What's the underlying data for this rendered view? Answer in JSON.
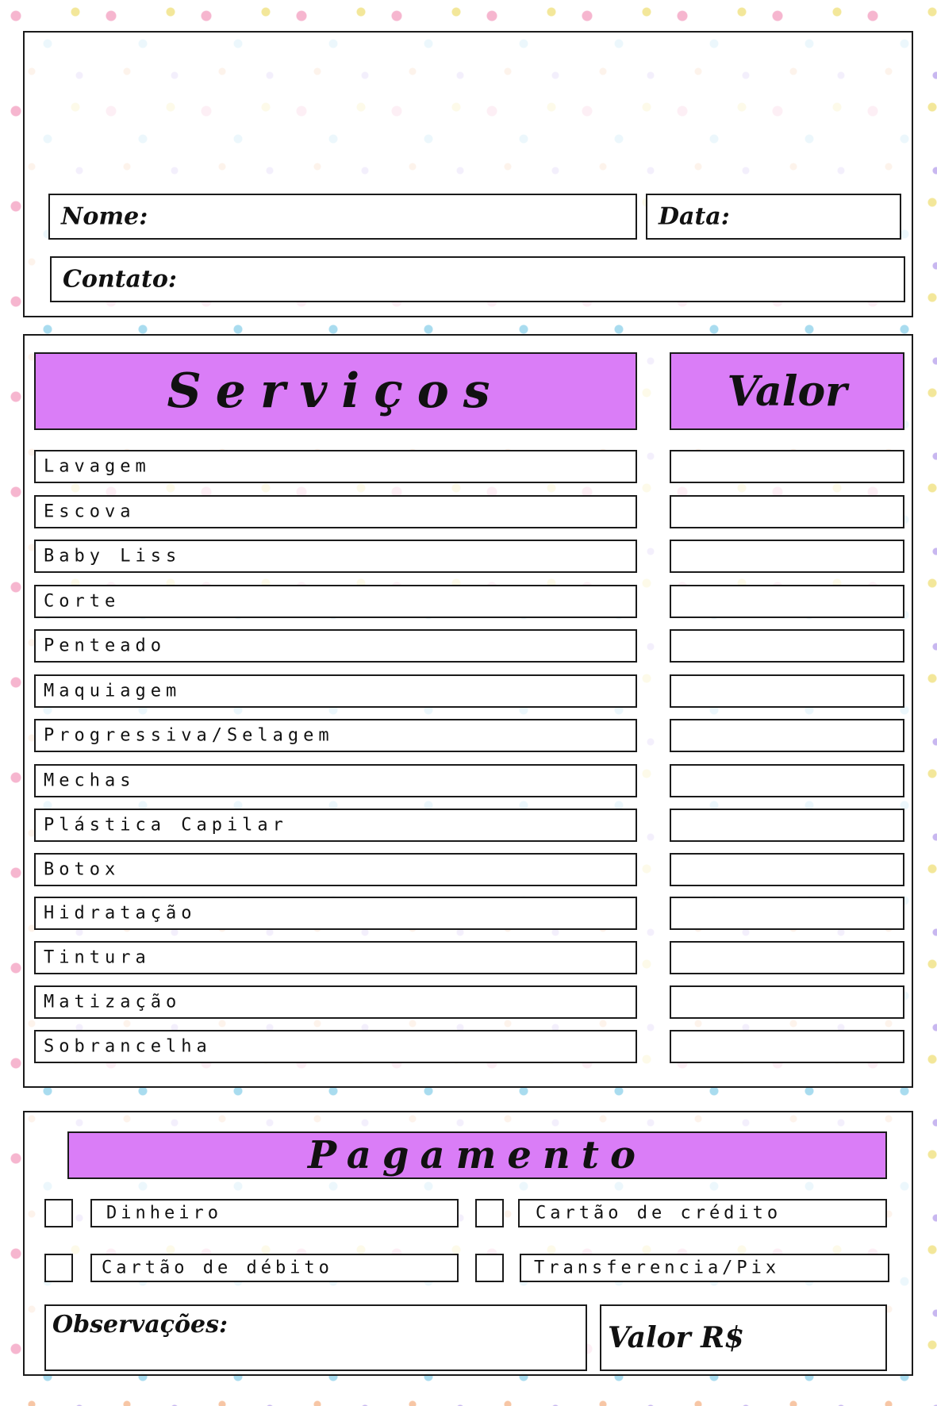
{
  "header": {
    "name_label": "Nome:",
    "date_label": "Data:",
    "contact_label": "Contato:"
  },
  "services": {
    "title": "Serviços",
    "value_title": "Valor",
    "items": [
      "Lavagem",
      "Escova",
      "Baby Liss",
      "Corte",
      "Penteado",
      "Maquiagem",
      "Progressiva/Selagem",
      "Mechas",
      "Plástica Capilar",
      "Botox",
      "Hidratação",
      "Tintura",
      "Matização",
      "Sobrancelha"
    ]
  },
  "payment": {
    "title": "Pagamento",
    "options": [
      "Dinheiro",
      "Cartão de crédito",
      "Cartão de débito",
      "Transferencia/Pix"
    ],
    "notes_label": "Observações:",
    "total_label": "Valor R$"
  }
}
